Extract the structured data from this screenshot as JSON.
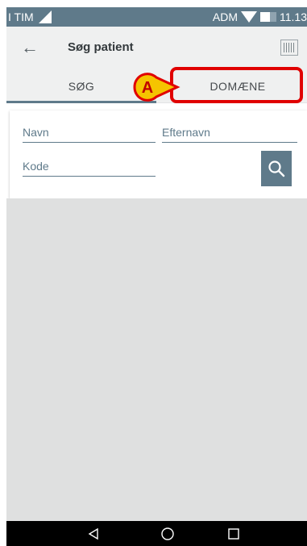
{
  "status_bar": {
    "carrier": "I TIM",
    "operator": "ADM",
    "time": "11.13",
    "icons": [
      "signal-icon",
      "wifi-icon",
      "battery-icon"
    ]
  },
  "app_bar": {
    "title": "Søg patient",
    "back_icon": "arrow-left-icon",
    "action_icon": "barcode-scanner-icon"
  },
  "tabs": [
    {
      "label": "SØG",
      "selected": true
    },
    {
      "label": "DOMÆNE",
      "selected": false
    }
  ],
  "annotation": {
    "label": "A",
    "highlight_color": "#e00000",
    "callout_color": "#f5c400"
  },
  "search_form": {
    "first_name_placeholder": "Navn",
    "last_name_placeholder": "Efternavn",
    "code_placeholder": "Kode",
    "search_icon": "search-icon"
  },
  "nav_bar": {
    "icons": [
      "back-triangle-icon",
      "home-circle-icon",
      "recents-square-icon"
    ]
  },
  "colors": {
    "primary": "#5f7a8a",
    "app_bar_bg": "#eff0f0",
    "content_bg": "#dfe0e0"
  }
}
